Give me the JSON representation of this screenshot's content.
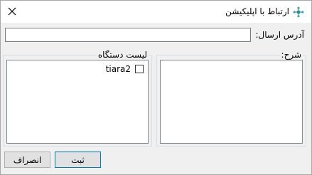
{
  "window": {
    "title": "ارتباط با اپلیکیشن",
    "icon": "app-logo-icon",
    "close_icon": "close-icon"
  },
  "form": {
    "address_label": "آدرس ارسال:",
    "address_value": ""
  },
  "devices_group": {
    "legend": "لیست دستگاه",
    "items": [
      {
        "label": "tiara2",
        "checked": false
      }
    ]
  },
  "description_group": {
    "legend": "شرح:",
    "value": ""
  },
  "buttons": {
    "submit_label": "ثبت",
    "cancel_label": "انصراف"
  },
  "colors": {
    "accent_border": "#0078d7",
    "icon_teal": "#2e8b9a"
  }
}
